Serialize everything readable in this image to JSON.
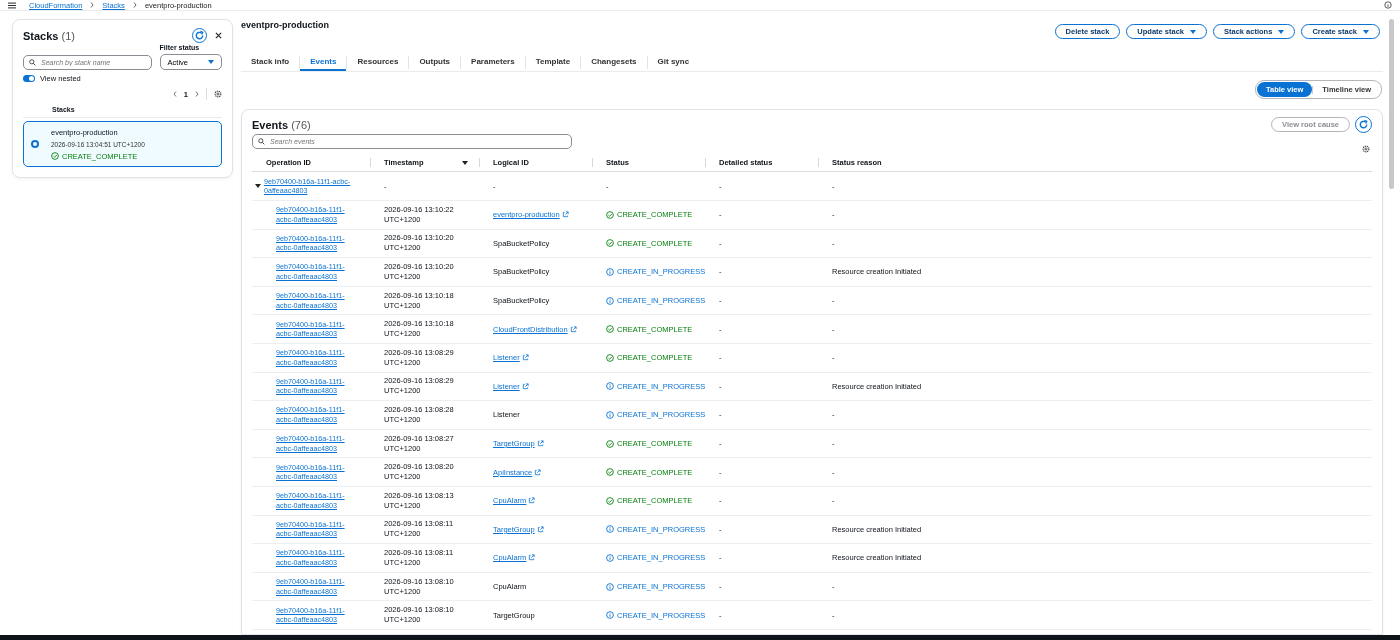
{
  "breadcrumbs": [
    {
      "label": "CloudFormation",
      "link": true
    },
    {
      "label": "Stacks",
      "link": true
    },
    {
      "label": "eventpro-production",
      "link": false
    }
  ],
  "stacks_panel": {
    "title": "Stacks",
    "count": "(1)",
    "filter_label": "Filter status",
    "filter_value": "Active",
    "search_placeholder": "Search by stack name",
    "view_nested": {
      "label": "View nested",
      "on": true
    },
    "page": "1",
    "column": "Stacks",
    "items": [
      {
        "name": "eventpro-production",
        "time": "2026-09-16 13:04:51 UTC+1200",
        "status": "CREATE_COMPLETE",
        "selected": true
      }
    ]
  },
  "stack_title": "eventpro-production",
  "actions": [
    {
      "label": "Delete stack",
      "dropdown": false
    },
    {
      "label": "Update stack",
      "dropdown": true
    },
    {
      "label": "Stack actions",
      "dropdown": true
    },
    {
      "label": "Create stack",
      "dropdown": true
    }
  ],
  "tabs": [
    {
      "label": "Stack info",
      "selected": false
    },
    {
      "label": "Events",
      "selected": true
    },
    {
      "label": "Resources",
      "selected": false
    },
    {
      "label": "Outputs",
      "selected": false
    },
    {
      "label": "Parameters",
      "selected": false
    },
    {
      "label": "Template",
      "selected": false
    },
    {
      "label": "Changesets",
      "selected": false
    },
    {
      "label": "Git sync",
      "selected": false
    }
  ],
  "views": [
    {
      "label": "Table view",
      "selected": true
    },
    {
      "label": "Timeline view",
      "selected": false
    }
  ],
  "events": {
    "title": "Events",
    "count": "(76)",
    "root_cause_button": {
      "label": "View root cause",
      "disabled": true
    },
    "search_placeholder": "Search events",
    "columns": [
      {
        "label": "Operation ID",
        "sorted": false
      },
      {
        "label": "Timestamp",
        "sorted": true
      },
      {
        "label": "Logical ID",
        "sorted": false
      },
      {
        "label": "Status",
        "sorted": false
      },
      {
        "label": "Detailed status",
        "sorted": false
      },
      {
        "label": "Status reason",
        "sorted": false
      }
    ],
    "rows": [
      {
        "operation_id": "9eb70400-b16a-11f1-acbc-0affeaac4803",
        "timestamp": "-",
        "logical_id": "-",
        "status": "-",
        "detailed_status": "-",
        "status_reason": "-",
        "expanded": true,
        "children": [
          {
            "operation_id": "9eb70400-b16a-11f1-acbc-0affeaac4803",
            "timestamp": "2026-09-16 13:10:22 UTC+1200",
            "logical_id": "eventpro-production",
            "link": true,
            "status": "CREATE_COMPLETE",
            "kind": "complete",
            "detailed_status": "-",
            "status_reason": "-"
          },
          {
            "operation_id": "9eb70400-b16a-11f1-acbc-0affeaac4803",
            "timestamp": "2026-09-16 13:10:20 UTC+1200",
            "logical_id": "SpaBucketPolicy",
            "link": false,
            "status": "CREATE_COMPLETE",
            "kind": "complete",
            "detailed_status": "-",
            "status_reason": "-"
          },
          {
            "operation_id": "9eb70400-b16a-11f1-acbc-0affeaac4803",
            "timestamp": "2026-09-16 13:10:20 UTC+1200",
            "logical_id": "SpaBucketPolicy",
            "link": false,
            "status": "CREATE_IN_PROGRESS",
            "kind": "in_progress",
            "detailed_status": "-",
            "status_reason": "Resource creation Initiated"
          },
          {
            "operation_id": "9eb70400-b16a-11f1-acbc-0affeaac4803",
            "timestamp": "2026-09-16 13:10:18 UTC+1200",
            "logical_id": "SpaBucketPolicy",
            "link": false,
            "status": "CREATE_IN_PROGRESS",
            "kind": "in_progress",
            "detailed_status": "-",
            "status_reason": "-"
          },
          {
            "operation_id": "9eb70400-b16a-11f1-acbc-0affeaac4803",
            "timestamp": "2026-09-16 13:10:18 UTC+1200",
            "logical_id": "CloudFrontDistribution",
            "link": true,
            "status": "CREATE_COMPLETE",
            "kind": "complete",
            "detailed_status": "-",
            "status_reason": "-"
          },
          {
            "operation_id": "9eb70400-b16a-11f1-acbc-0affeaac4803",
            "timestamp": "2026-09-16 13:08:29 UTC+1200",
            "logical_id": "Listener",
            "link": true,
            "status": "CREATE_COMPLETE",
            "kind": "complete",
            "detailed_status": "-",
            "status_reason": "-"
          },
          {
            "operation_id": "9eb70400-b16a-11f1-acbc-0affeaac4803",
            "timestamp": "2026-09-16 13:08:29 UTC+1200",
            "logical_id": "Listener",
            "link": true,
            "status": "CREATE_IN_PROGRESS",
            "kind": "in_progress",
            "detailed_status": "-",
            "status_reason": "Resource creation Initiated"
          },
          {
            "operation_id": "9eb70400-b16a-11f1-acbc-0affeaac4803",
            "timestamp": "2026-09-16 13:08:28 UTC+1200",
            "logical_id": "Listener",
            "link": false,
            "status": "CREATE_IN_PROGRESS",
            "kind": "in_progress",
            "detailed_status": "-",
            "status_reason": "-"
          },
          {
            "operation_id": "9eb70400-b16a-11f1-acbc-0affeaac4803",
            "timestamp": "2026-09-16 13:08:27 UTC+1200",
            "logical_id": "TargetGroup",
            "link": true,
            "status": "CREATE_COMPLETE",
            "kind": "complete",
            "detailed_status": "-",
            "status_reason": "-"
          },
          {
            "operation_id": "9eb70400-b16a-11f1-acbc-0affeaac4803",
            "timestamp": "2026-09-16 13:08:20 UTC+1200",
            "logical_id": "ApiInstance",
            "link": true,
            "status": "CREATE_COMPLETE",
            "kind": "complete",
            "detailed_status": "-",
            "status_reason": "-"
          },
          {
            "operation_id": "9eb70400-b16a-11f1-acbc-0affeaac4803",
            "timestamp": "2026-09-16 13:08:13 UTC+1200",
            "logical_id": "CpuAlarm",
            "link": true,
            "status": "CREATE_COMPLETE",
            "kind": "complete",
            "detailed_status": "-",
            "status_reason": "-"
          },
          {
            "operation_id": "9eb70400-b16a-11f1-acbc-0affeaac4803",
            "timestamp": "2026-09-16 13:08:11 UTC+1200",
            "logical_id": "TargetGroup",
            "link": true,
            "status": "CREATE_IN_PROGRESS",
            "kind": "in_progress",
            "detailed_status": "-",
            "status_reason": "Resource creation Initiated"
          },
          {
            "operation_id": "9eb70400-b16a-11f1-acbc-0affeaac4803",
            "timestamp": "2026-09-16 13:08:11 UTC+1200",
            "logical_id": "CpuAlarm",
            "link": true,
            "status": "CREATE_IN_PROGRESS",
            "kind": "in_progress",
            "detailed_status": "-",
            "status_reason": "Resource creation Initiated"
          },
          {
            "operation_id": "9eb70400-b16a-11f1-acbc-0affeaac4803",
            "timestamp": "2026-09-16 13:08:10 UTC+1200",
            "logical_id": "CpuAlarm",
            "link": false,
            "status": "CREATE_IN_PROGRESS",
            "kind": "in_progress",
            "detailed_status": "-",
            "status_reason": "-"
          },
          {
            "operation_id": "9eb70400-b16a-11f1-acbc-0affeaac4803",
            "timestamp": "2026-09-16 13:08:10 UTC+1200",
            "logical_id": "TargetGroup",
            "link": false,
            "status": "CREATE_IN_PROGRESS",
            "kind": "in_progress",
            "detailed_status": "-",
            "status_reason": "-"
          }
        ]
      }
    ]
  }
}
